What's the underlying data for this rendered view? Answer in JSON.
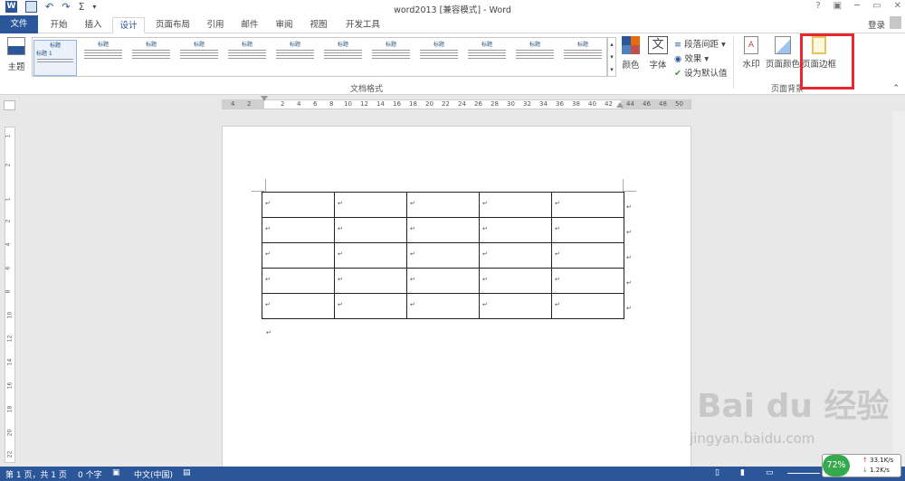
{
  "title": "word2013 [兼容模式] - Word",
  "window_controls": [
    "?",
    "▣",
    "─",
    "▭",
    "✕"
  ],
  "login": "登录",
  "tabs": [
    "文件",
    "开始",
    "插入",
    "设计",
    "页面布局",
    "引用",
    "邮件",
    "审阅",
    "视图",
    "开发工具"
  ],
  "active_tab": "设计",
  "ribbon": {
    "theme_label": "主题",
    "colors_label": "颜色",
    "fonts_label": "字体",
    "font_icon_char": "文",
    "paragraph_spacing": "段落间距",
    "effects": "效果",
    "set_default": "设为默认值",
    "watermark": "水印",
    "page_color": "页面颜色",
    "page_borders": "页面边框",
    "group_doc_format": "文档格式",
    "group_page_bg": "页面背景",
    "gallery_heading": "标题",
    "gallery_heading1": "标题 1"
  },
  "ruler_h": [
    "4",
    "2",
    "2",
    "4",
    "6",
    "8",
    "10",
    "12",
    "14",
    "16",
    "18",
    "20",
    "22",
    "24",
    "26",
    "28",
    "30",
    "32",
    "34",
    "36",
    "38",
    "40",
    "42",
    "44",
    "46",
    "48",
    "50"
  ],
  "ruler_v": [
    "1",
    "2",
    "1",
    "2",
    "4",
    "6",
    "8",
    "10",
    "12",
    "14",
    "16",
    "18",
    "20",
    "22"
  ],
  "table": {
    "rows": 5,
    "cols": 5,
    "cell_mark": "↵"
  },
  "paragraph_mark": "↵",
  "status": {
    "page": "第 1 页，共 1 页",
    "words": "0 个字",
    "lang": "中文(中国)"
  },
  "net": {
    "percent": "72%",
    "up": "33.1K/s",
    "down": "1.2K/s"
  },
  "watermark_text": "Bai du 经验",
  "watermark_url": "jingyan.baidu.com",
  "colors": {
    "accent": "#2b579a",
    "highlight": "#e8282e"
  }
}
